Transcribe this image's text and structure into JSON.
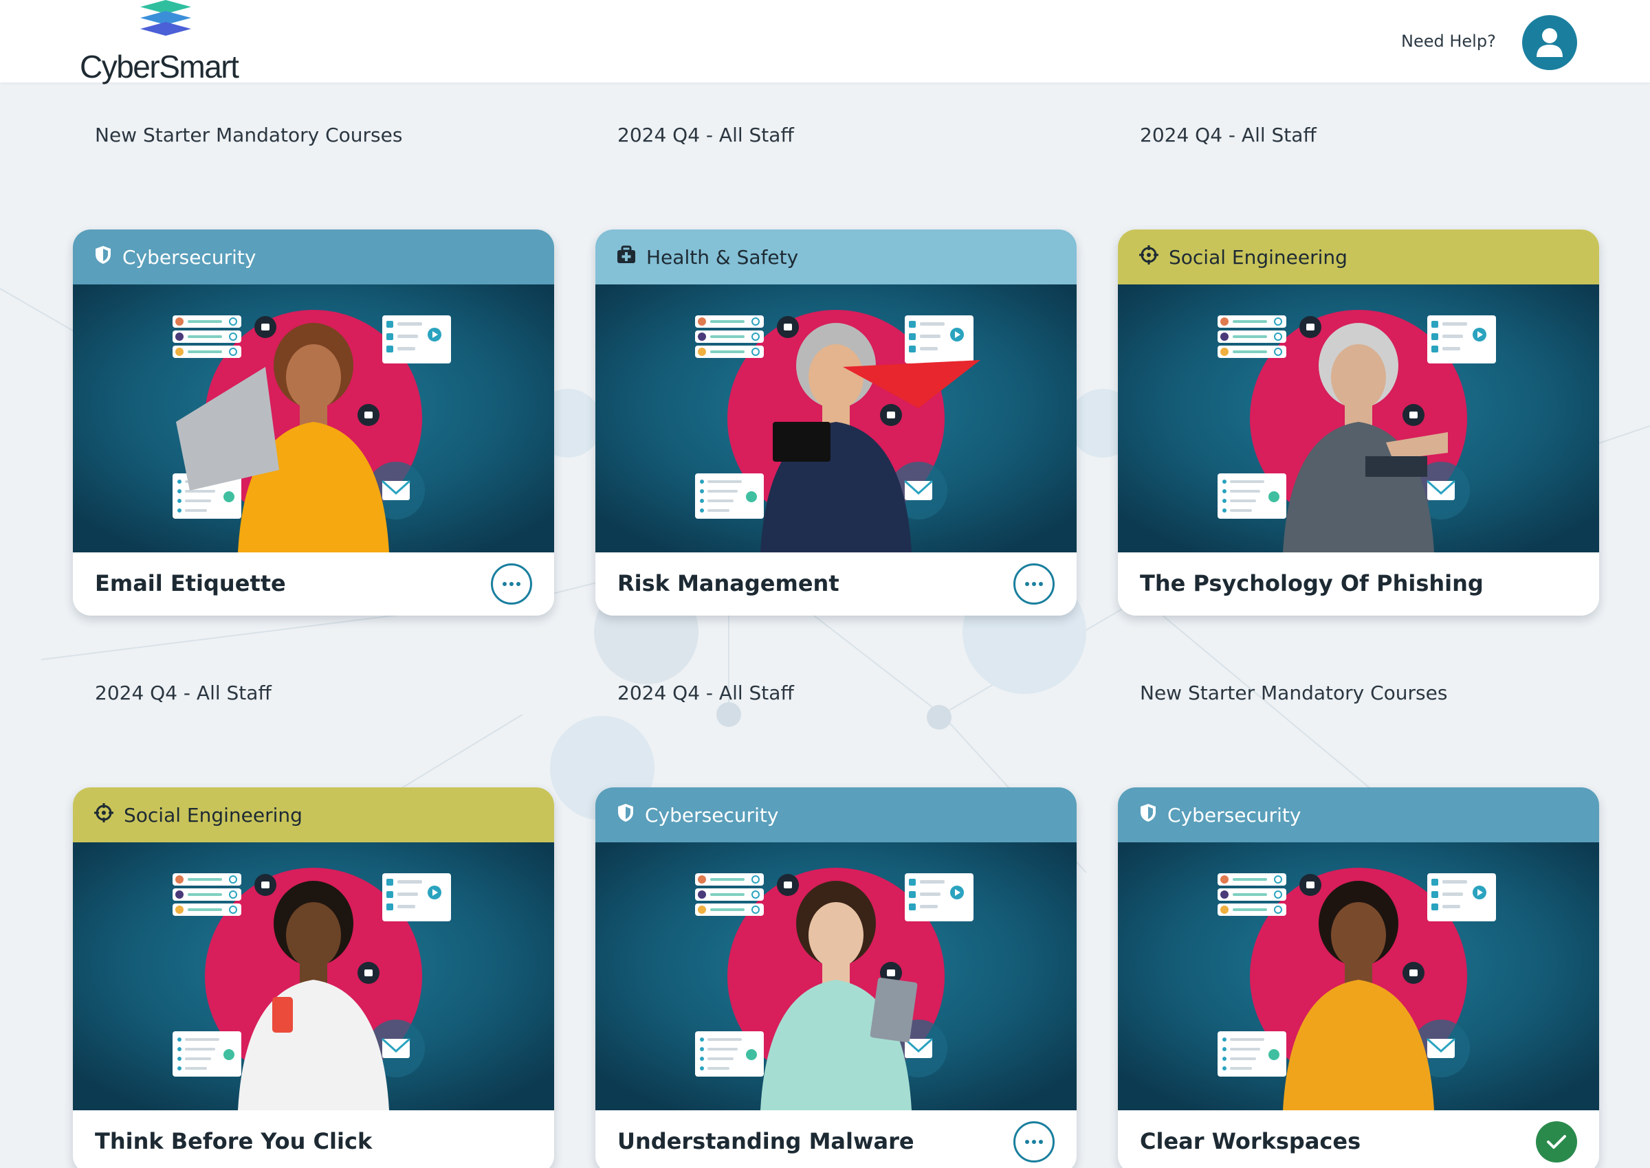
{
  "brand": {
    "name": "CyberSmart",
    "logo_colors": [
      "#2fbf9f",
      "#3b8fd9",
      "#4b5fd6"
    ]
  },
  "header": {
    "help_label": "Need Help?",
    "account_icon": "user-icon"
  },
  "colors": {
    "cybersecurity": "#5a9fbb",
    "health_safety": "#84c0d6",
    "social_engineering": "#c9c45a",
    "accent": "#1a7f9e",
    "complete": "#2a8a4c",
    "image_magenta": "#d81e5b"
  },
  "courses": [
    {
      "group": "New Starter Mandatory Courses",
      "category": "Cybersecurity",
      "category_icon": "shield-icon",
      "title": "Email Etiquette",
      "status": "in-progress"
    },
    {
      "group": "2024 Q4 - All Staff",
      "category": "Health & Safety",
      "category_icon": "first-aid-icon",
      "title": "Risk Management",
      "status": "in-progress"
    },
    {
      "group": "2024 Q4 - All Staff",
      "category": "Social Engineering",
      "category_icon": "crosshair-icon",
      "title": "The Psychology Of Phishing",
      "status": "none"
    },
    {
      "group": "2024 Q4 - All Staff",
      "category": "Social Engineering",
      "category_icon": "crosshair-icon",
      "title": "Think Before You Click",
      "status": "none"
    },
    {
      "group": "2024 Q4 - All Staff",
      "category": "Cybersecurity",
      "category_icon": "shield-icon",
      "title": "Understanding Malware",
      "status": "in-progress"
    },
    {
      "group": "New Starter Mandatory Courses",
      "category": "Cybersecurity",
      "category_icon": "shield-icon",
      "title": "Clear Workspaces",
      "status": "complete"
    }
  ]
}
